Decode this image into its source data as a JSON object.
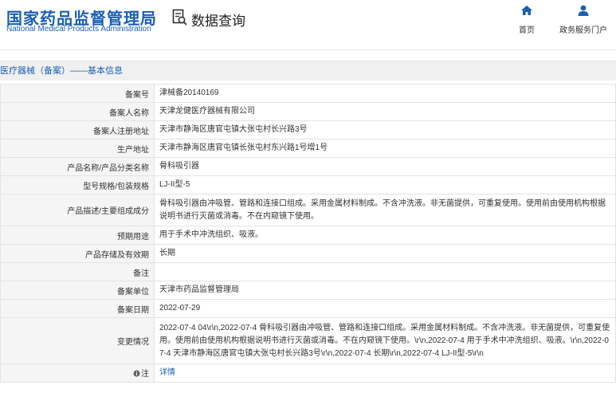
{
  "header": {
    "logo_cn": "国家药品监督管理局",
    "logo_en": "National Medical Products Administration",
    "search_title": "数据查询",
    "nav_home": "首页",
    "nav_gov": "政务服务门户"
  },
  "section_title": "医疗器械（备案）——基本信息",
  "rows": [
    {
      "label": "备案号",
      "value": "津械备20140169"
    },
    {
      "label": "备案人名称",
      "value": "天津龙健医疗器械有限公司"
    },
    {
      "label": "备案人注册地址",
      "value": "天津市静海区唐官屯镇大张屯村长兴路3号"
    },
    {
      "label": "生产地址",
      "value": "天津市静海区唐官屯镇长张屯村东兴路1号增1号"
    },
    {
      "label": "产品名称/产品分类名称",
      "value": "骨科吸引器"
    },
    {
      "label": "型号规格/包装规格",
      "value": "LJ-II型-5"
    },
    {
      "label": "产品描述/主要组成成分",
      "value": "骨科吸引器由冲吸管、管路和连接口组成。采用金属材料制成。不含冲洗液。非无菌提供，可重复使用。使用前由使用机构根据说明书进行灭菌或消毒。不在内窥镜下使用。"
    },
    {
      "label": "预期用途",
      "value": "用于手术中冲洗组织、吸液。"
    },
    {
      "label": "产品存储及有效期",
      "value": "长期"
    },
    {
      "label": "备注",
      "value": ""
    },
    {
      "label": "备案单位",
      "value": "天津市药品监督管理局"
    },
    {
      "label": "备案日期",
      "value": "2022-07-29"
    },
    {
      "label": "变更情况",
      "value": "2022-07-4 04\\r\\n,2022-07-4 骨科吸引器由冲吸管、管路和连接口组成。采用金属材料制成。不含冲洗液。非无菌提供，可重复使用。使用前由使用机构根据说明书进行灭菌或消毒。不在内窥镜下使用。\\r\\n,2022-07-4 用于手术中冲洗组织、吸液。\\r\\n,2022-07-4 天津市静海区唐官屯镇大张屯村长兴路3号\\r\\n,2022-07-4 长期\\r\\n,2022-07-4 LJ-II型-5\\r\\n"
    },
    {
      "label": "注",
      "value": "详情",
      "label_icon": "info-icon"
    }
  ],
  "colors": {
    "brand": "#1a5fb4",
    "label_bg": "#f5f5f5",
    "section_bg": "#f0f0f0"
  }
}
